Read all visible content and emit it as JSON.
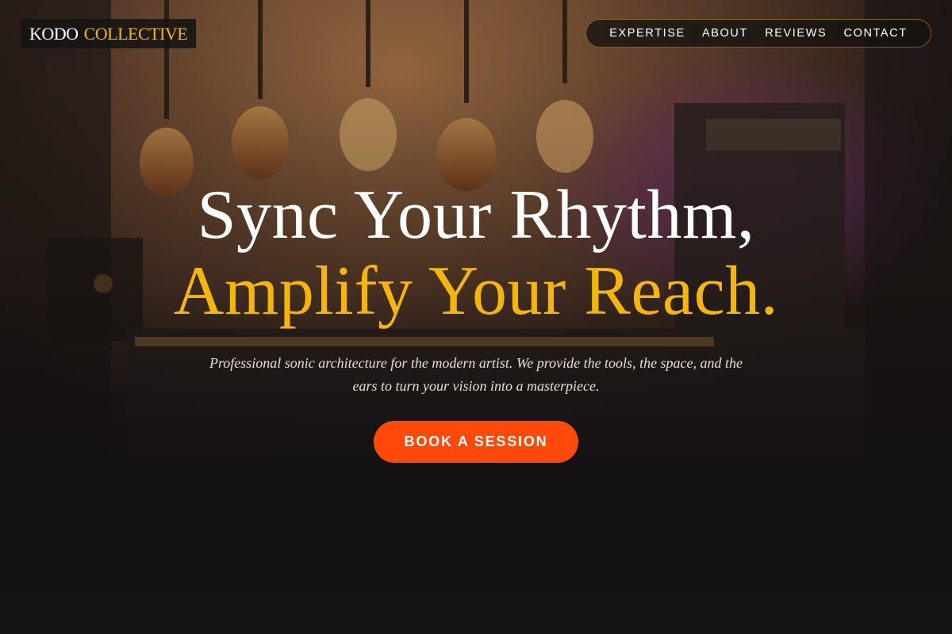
{
  "brand": {
    "name_part_1": "KODO",
    "name_part_2": "COLLECTIVE"
  },
  "nav": {
    "items": [
      "EXPERTISE",
      "ABOUT",
      "REVIEWS",
      "CONTACT"
    ]
  },
  "hero": {
    "heading_line_1": "Sync Your Rhythm,",
    "heading_line_2": "Amplify Your Reach.",
    "tagline": "Professional sonic architecture for the modern artist. We provide the tools, the space, and the ears to turn your vision into a masterpiece.",
    "cta_label": "BOOK A SESSION"
  },
  "colors": {
    "accent": "#f5b50f",
    "cta": "#ff4a0c",
    "background": "#141212",
    "text": "#ffffff"
  }
}
